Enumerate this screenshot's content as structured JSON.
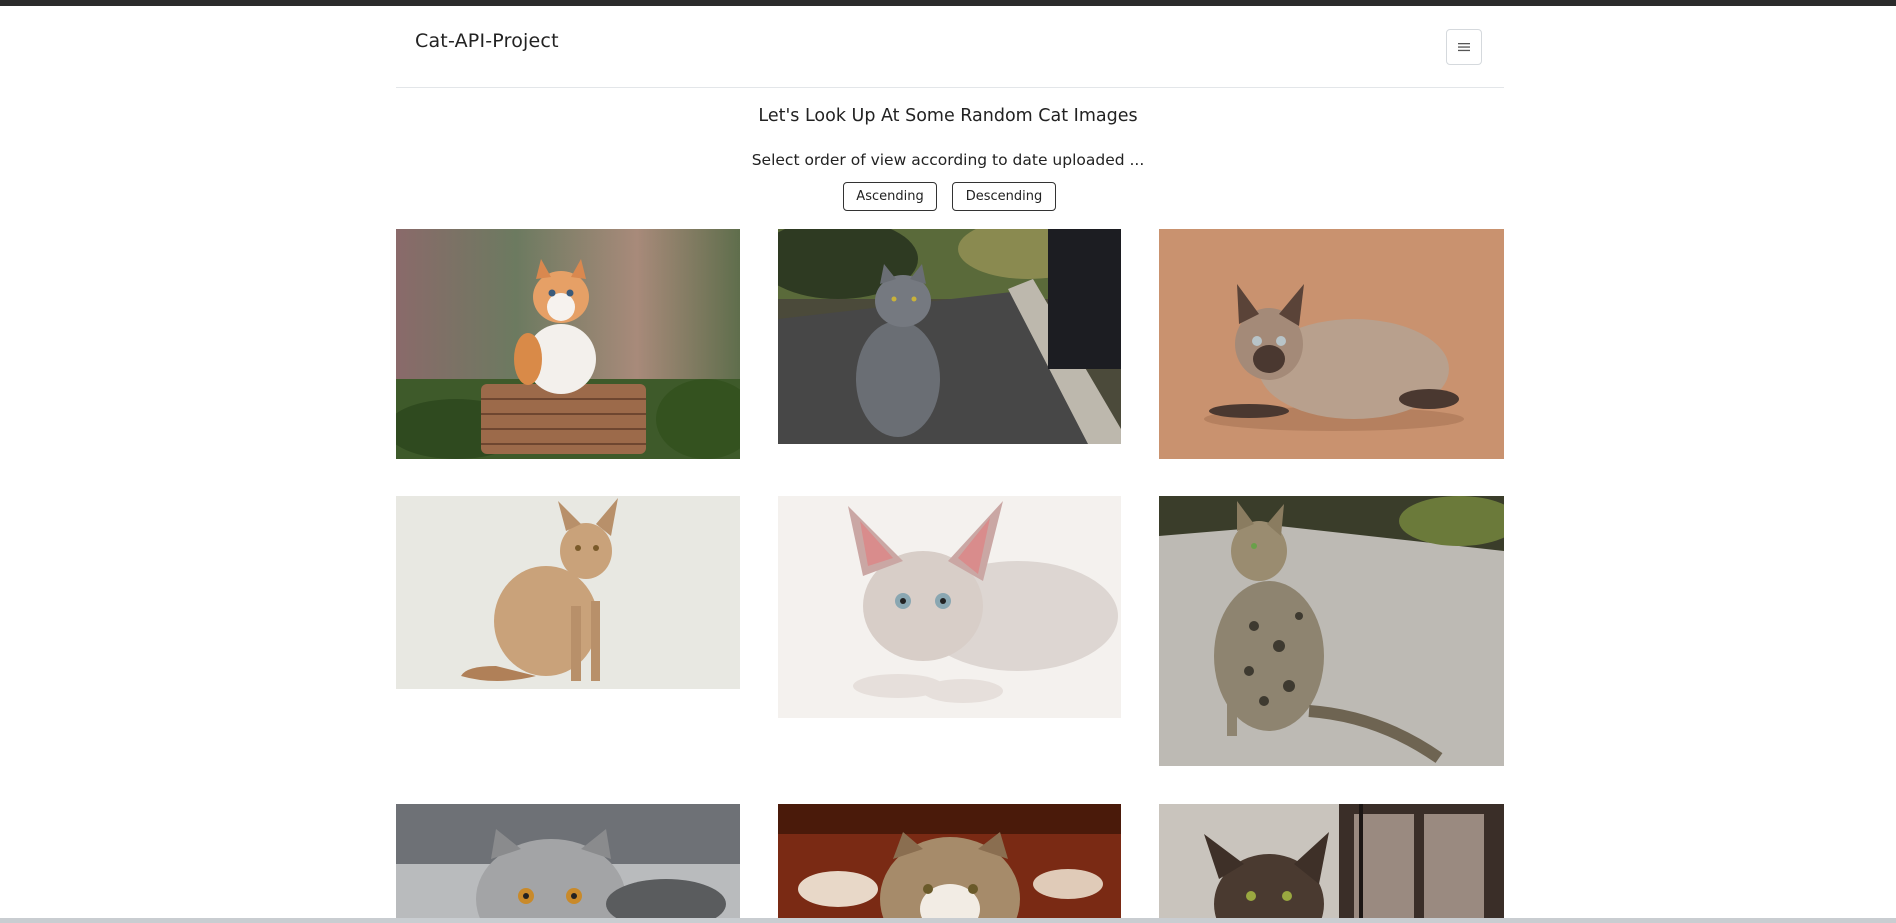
{
  "navbar": {
    "brand": "Cat-API-Project",
    "menu_icon": "hamburger-menu-icon"
  },
  "header": {
    "title": "Let's Look Up At Some Random Cat Images",
    "subtitle": "Select order of view according to date uploaded ..."
  },
  "sort_buttons": {
    "ascending": "Ascending",
    "descending": "Descending"
  },
  "gallery": {
    "images": [
      {
        "subject": "fluffy orange and white kitten sitting on a wicker basket"
      },
      {
        "subject": "grey british shorthair cat sitting on a road"
      },
      {
        "subject": "sphynx-like cat lying on a tan background"
      },
      {
        "subject": "tan devon rex cat sitting on a white background"
      },
      {
        "subject": "pale hairless kitten lying down"
      },
      {
        "subject": "spotted bengal cat sitting on pavement"
      },
      {
        "subject": "silver tabby exotic shorthair cat"
      },
      {
        "subject": "exotic shorthair cat with brown and white fur"
      },
      {
        "subject": "dark brown oriental cat in front of a window"
      }
    ]
  },
  "colors": {
    "top_bar": "#2b2b2b",
    "text": "#222222",
    "button_border": "#333333",
    "divider": "#e3e6e9"
  }
}
